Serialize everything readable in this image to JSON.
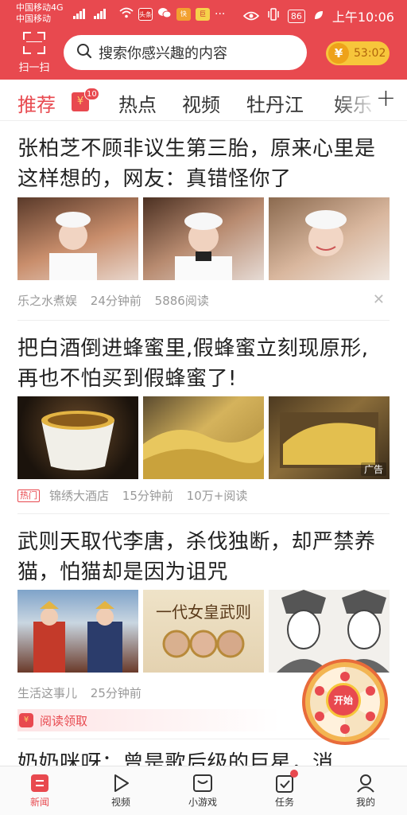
{
  "status_bar": {
    "carrier_1": "中国移动4G",
    "carrier_2": "中国移动",
    "battery": "86",
    "time": "上午10:06",
    "app_badge_1": "头条",
    "app_badge_2": "快",
    "app_badge_3": "巨"
  },
  "header": {
    "scan_label": "扫一扫",
    "search_placeholder": "搜索你感兴趣的内容",
    "coin_symbol": "¥",
    "coin_value": "53:02"
  },
  "tabs": {
    "items": [
      "推荐",
      "热点",
      "视频",
      "牡丹江",
      "娱乐"
    ],
    "active_index": 0,
    "redpack_badge": "10",
    "redpack_symbol": "¥"
  },
  "articles": [
    {
      "title": "张柏芝不顾非议生第三胎，原来心里是这样想的，网友：真错怪你了",
      "source": "乐之水煮娱",
      "time": "24分钟前",
      "reads": "5886阅读",
      "close": "✕"
    },
    {
      "title": "把白酒倒进蜂蜜里,假蜂蜜立刻现原形,再也不怕买到假蜂蜜了!",
      "tag": "热门",
      "source": "锦绣大酒店",
      "time": "15分钟前",
      "reads": "10万+阅读",
      "ad_label": "广告"
    },
    {
      "title": "武则天取代李唐，杀伐独断，却严禁养猫，怕猫却是因为诅咒",
      "source": "生活这事儿",
      "time": "25分钟前",
      "reward": "阅读领取",
      "poster_text": "一代女皇武则"
    }
  ],
  "next_article_title": "奶奶咪呀：曾是歌后级的巨星，消",
  "wheel": {
    "label": "开始"
  },
  "bottom_nav": [
    {
      "label": "新闻",
      "icon": "news-icon",
      "active": true
    },
    {
      "label": "视频",
      "icon": "play-icon",
      "active": false
    },
    {
      "label": "小游戏",
      "icon": "game-icon",
      "active": false
    },
    {
      "label": "任务",
      "icon": "task-icon",
      "active": false
    },
    {
      "label": "我的",
      "icon": "profile-icon",
      "active": false
    }
  ],
  "colors": {
    "brand": "#e8494f",
    "coin": "#f7c63b"
  }
}
